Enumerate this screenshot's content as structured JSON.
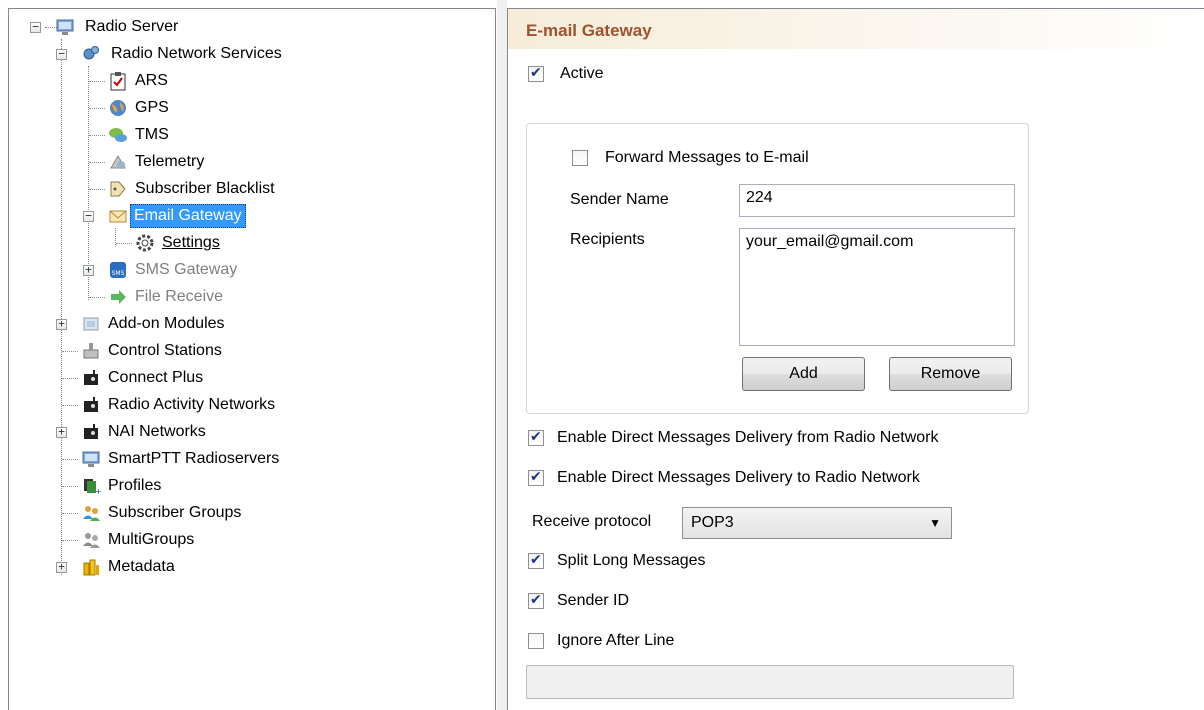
{
  "tree": {
    "root": "Radio Server",
    "services": "Radio Network Services",
    "ars": "ARS",
    "gps": "GPS",
    "tms": "TMS",
    "telemetry": "Telemetry",
    "blacklist": "Subscriber Blacklist",
    "email_gateway": "Email Gateway",
    "settings": "Settings",
    "sms_gateway": "SMS Gateway",
    "file_receive": "File Receive",
    "addon": "Add-on Modules",
    "control": "Control Stations",
    "connect_plus": "Connect Plus",
    "ran": "Radio Activity Networks",
    "nai": "NAI Networks",
    "smartptt": "SmartPTT Radioservers",
    "profiles": "Profiles",
    "sub_groups": "Subscriber Groups",
    "multigroups": "MultiGroups",
    "metadata": "Metadata"
  },
  "panel": {
    "title": "E-mail Gateway",
    "active_label": "Active",
    "active_checked": true,
    "forward_label": "Forward Messages to E-mail",
    "forward_checked": false,
    "sender_name_label": "Sender Name",
    "sender_name_value": "224",
    "recipients_label": "Recipients",
    "recipients_value": "your_email@gmail.com",
    "add_label": "Add",
    "remove_label": "Remove",
    "direct_from_label": "Enable Direct Messages Delivery from Radio Network",
    "direct_from_checked": true,
    "direct_to_label": "Enable Direct Messages Delivery to Radio Network",
    "direct_to_checked": true,
    "receive_protocol_label": "Receive protocol",
    "receive_protocol_value": "POP3",
    "split_label": "Split Long Messages",
    "split_checked": true,
    "sender_id_label": "Sender ID",
    "sender_id_checked": true,
    "ignore_label": "Ignore After Line",
    "ignore_checked": false,
    "ignore_value": ""
  },
  "colors": {
    "accent_title": "#a0522d",
    "selection": "#3399ff"
  }
}
